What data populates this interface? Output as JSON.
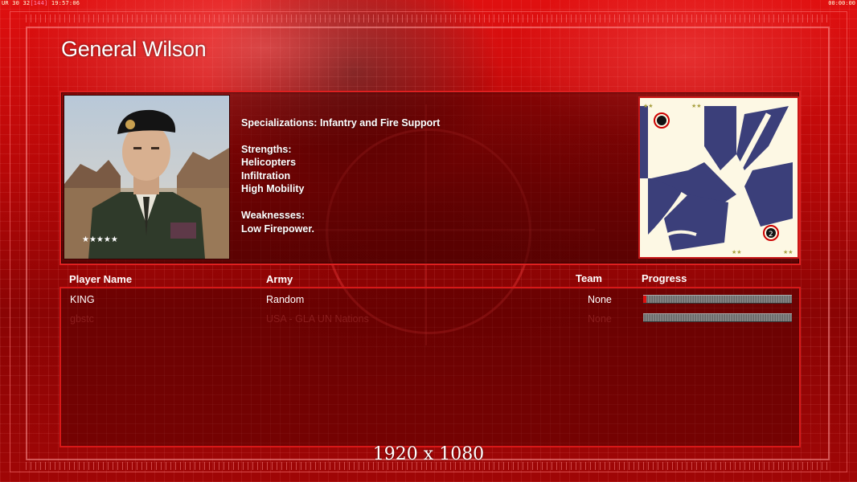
{
  "hud": {
    "left_text_a": "UR 30 32",
    "left_text_b": "[144]",
    "left_clock": "19:57:06",
    "right_clock": "00:00:00"
  },
  "general": {
    "name": "General Wilson",
    "specializations": "Specializations: Infantry and Fire Support",
    "strengths_header": "Strengths:",
    "strengths": [
      "Helicopters",
      "Infiltration",
      "High Mobility"
    ],
    "weaknesses_header": "Weaknesses:",
    "weaknesses": [
      "Low Firepower."
    ]
  },
  "minimap": {
    "start_positions": [
      "1",
      "2"
    ]
  },
  "lobby": {
    "headers": {
      "player": "Player Name",
      "army": "Army",
      "team": "Team",
      "progress": "Progress"
    },
    "players": [
      {
        "name": "KING",
        "army": "Random",
        "team": "None",
        "progress": 0.02
      },
      {
        "name": "gbstc",
        "army": "USA - GLA UN Nations",
        "team": "None",
        "progress": 0
      }
    ]
  },
  "overlay": {
    "resolution": "1920 x 1080"
  },
  "colors": {
    "accent_red": "#e02020",
    "progress_fill": "#e01010",
    "map_water": "#3b3f7a",
    "map_land": "#fdf8e4"
  }
}
